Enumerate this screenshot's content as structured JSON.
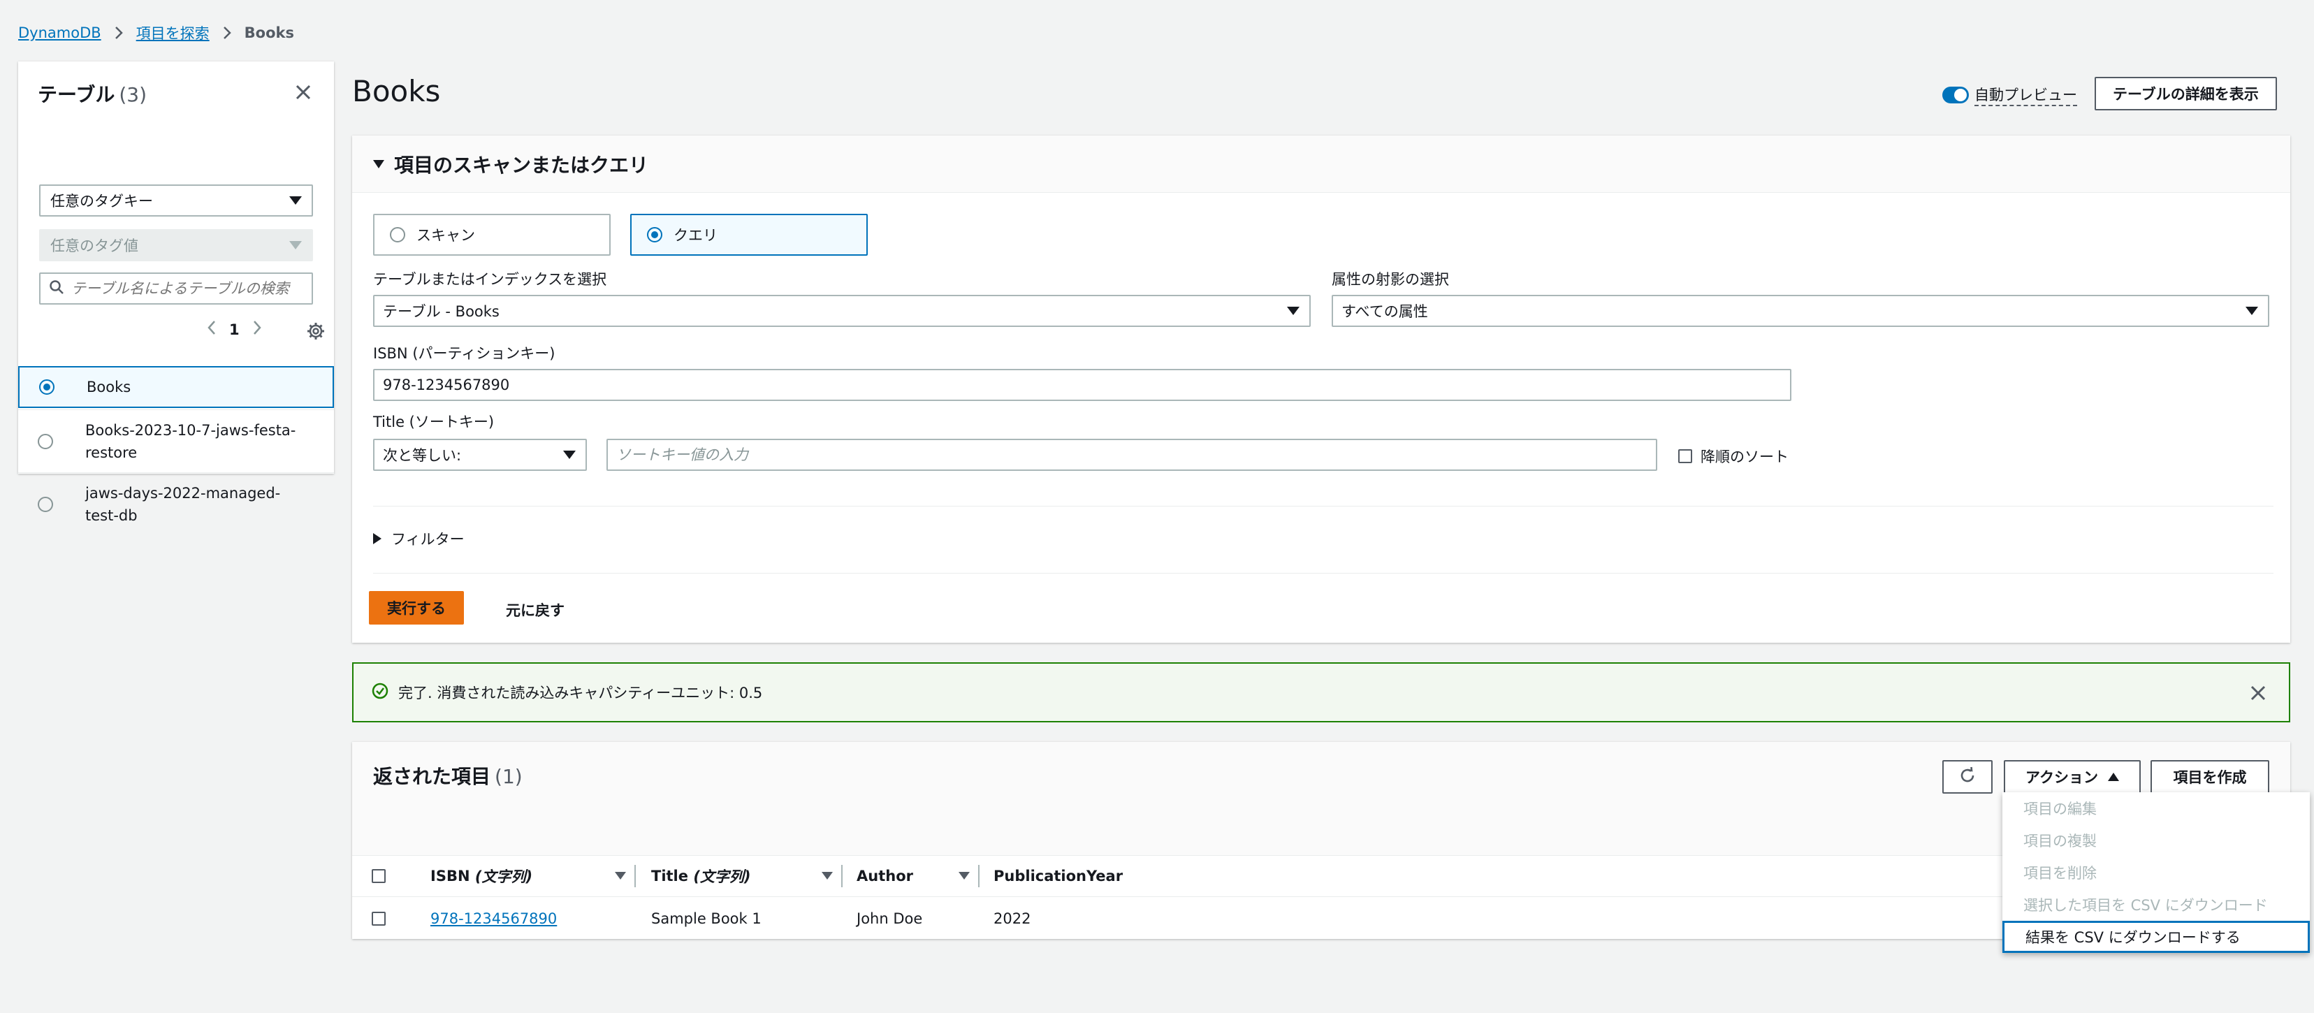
{
  "breadcrumb": {
    "root": "DynamoDB",
    "explore": "項目を探索",
    "current": "Books"
  },
  "sidebar": {
    "title": "テーブル",
    "count": "(3)",
    "tag_key_select": "任意のタグキー",
    "tag_value_select": "任意のタグ値",
    "search_placeholder": "テーブル名によるテーブルの検索",
    "page": "1",
    "tables": [
      {
        "name": "Books",
        "selected": true
      },
      {
        "name": "Books-2023-10-7-jaws-festa-restore",
        "selected": false
      },
      {
        "name": "jaws-days-2022-managed-test-db",
        "selected": false
      }
    ]
  },
  "header": {
    "title": "Books",
    "auto_preview_label": "自動プレビュー",
    "auto_preview_on": true,
    "view_details_label": "テーブルの詳細を表示"
  },
  "query_panel": {
    "title": "項目のスキャンまたはクエリ",
    "scan_label": "スキャン",
    "query_label": "クエリ",
    "selected_mode": "query",
    "table_index_label": "テーブルまたはインデックスを選択",
    "table_index_value": "テーブル - Books",
    "projection_label": "属性の射影の選択",
    "projection_value": "すべての属性",
    "partition_key_label": "ISBN (パーティションキー)",
    "partition_key_value": "978-1234567890",
    "sort_key_label": "Title (ソートキー)",
    "sort_condition_value": "次と等しい:",
    "sort_key_placeholder": "ソートキー値の入力",
    "descending_label": "降順のソート",
    "filter_label": "フィルター",
    "run_label": "実行する",
    "reset_label": "元に戻す"
  },
  "alert": {
    "message": "完了. 消費された読み込みキャパシティーユニット: 0.5"
  },
  "results": {
    "title": "返された項目",
    "count": "(1)",
    "actions_label": "アクション",
    "create_label": "項目を作成",
    "columns": [
      {
        "name": "ISBN",
        "type": "(文字列)"
      },
      {
        "name": "Title",
        "type": "(文字列)"
      },
      {
        "name": "Author",
        "type": ""
      },
      {
        "name": "PublicationYear",
        "type": ""
      }
    ],
    "rows": [
      {
        "isbn": "978-1234567890",
        "title": "Sample Book 1",
        "author": "John Doe",
        "year": "2022"
      }
    ]
  },
  "action_menu": {
    "items": [
      {
        "label": "項目の編集",
        "enabled": false
      },
      {
        "label": "項目の複製",
        "enabled": false
      },
      {
        "label": "項目を削除",
        "enabled": false
      },
      {
        "label": "選択した項目を CSV にダウンロード",
        "enabled": false
      },
      {
        "label": "結果を CSV にダウンロードする",
        "enabled": true
      }
    ]
  },
  "colors": {
    "accent": "#0073bb",
    "primary_button": "#ec7211",
    "success": "#1d8102"
  }
}
